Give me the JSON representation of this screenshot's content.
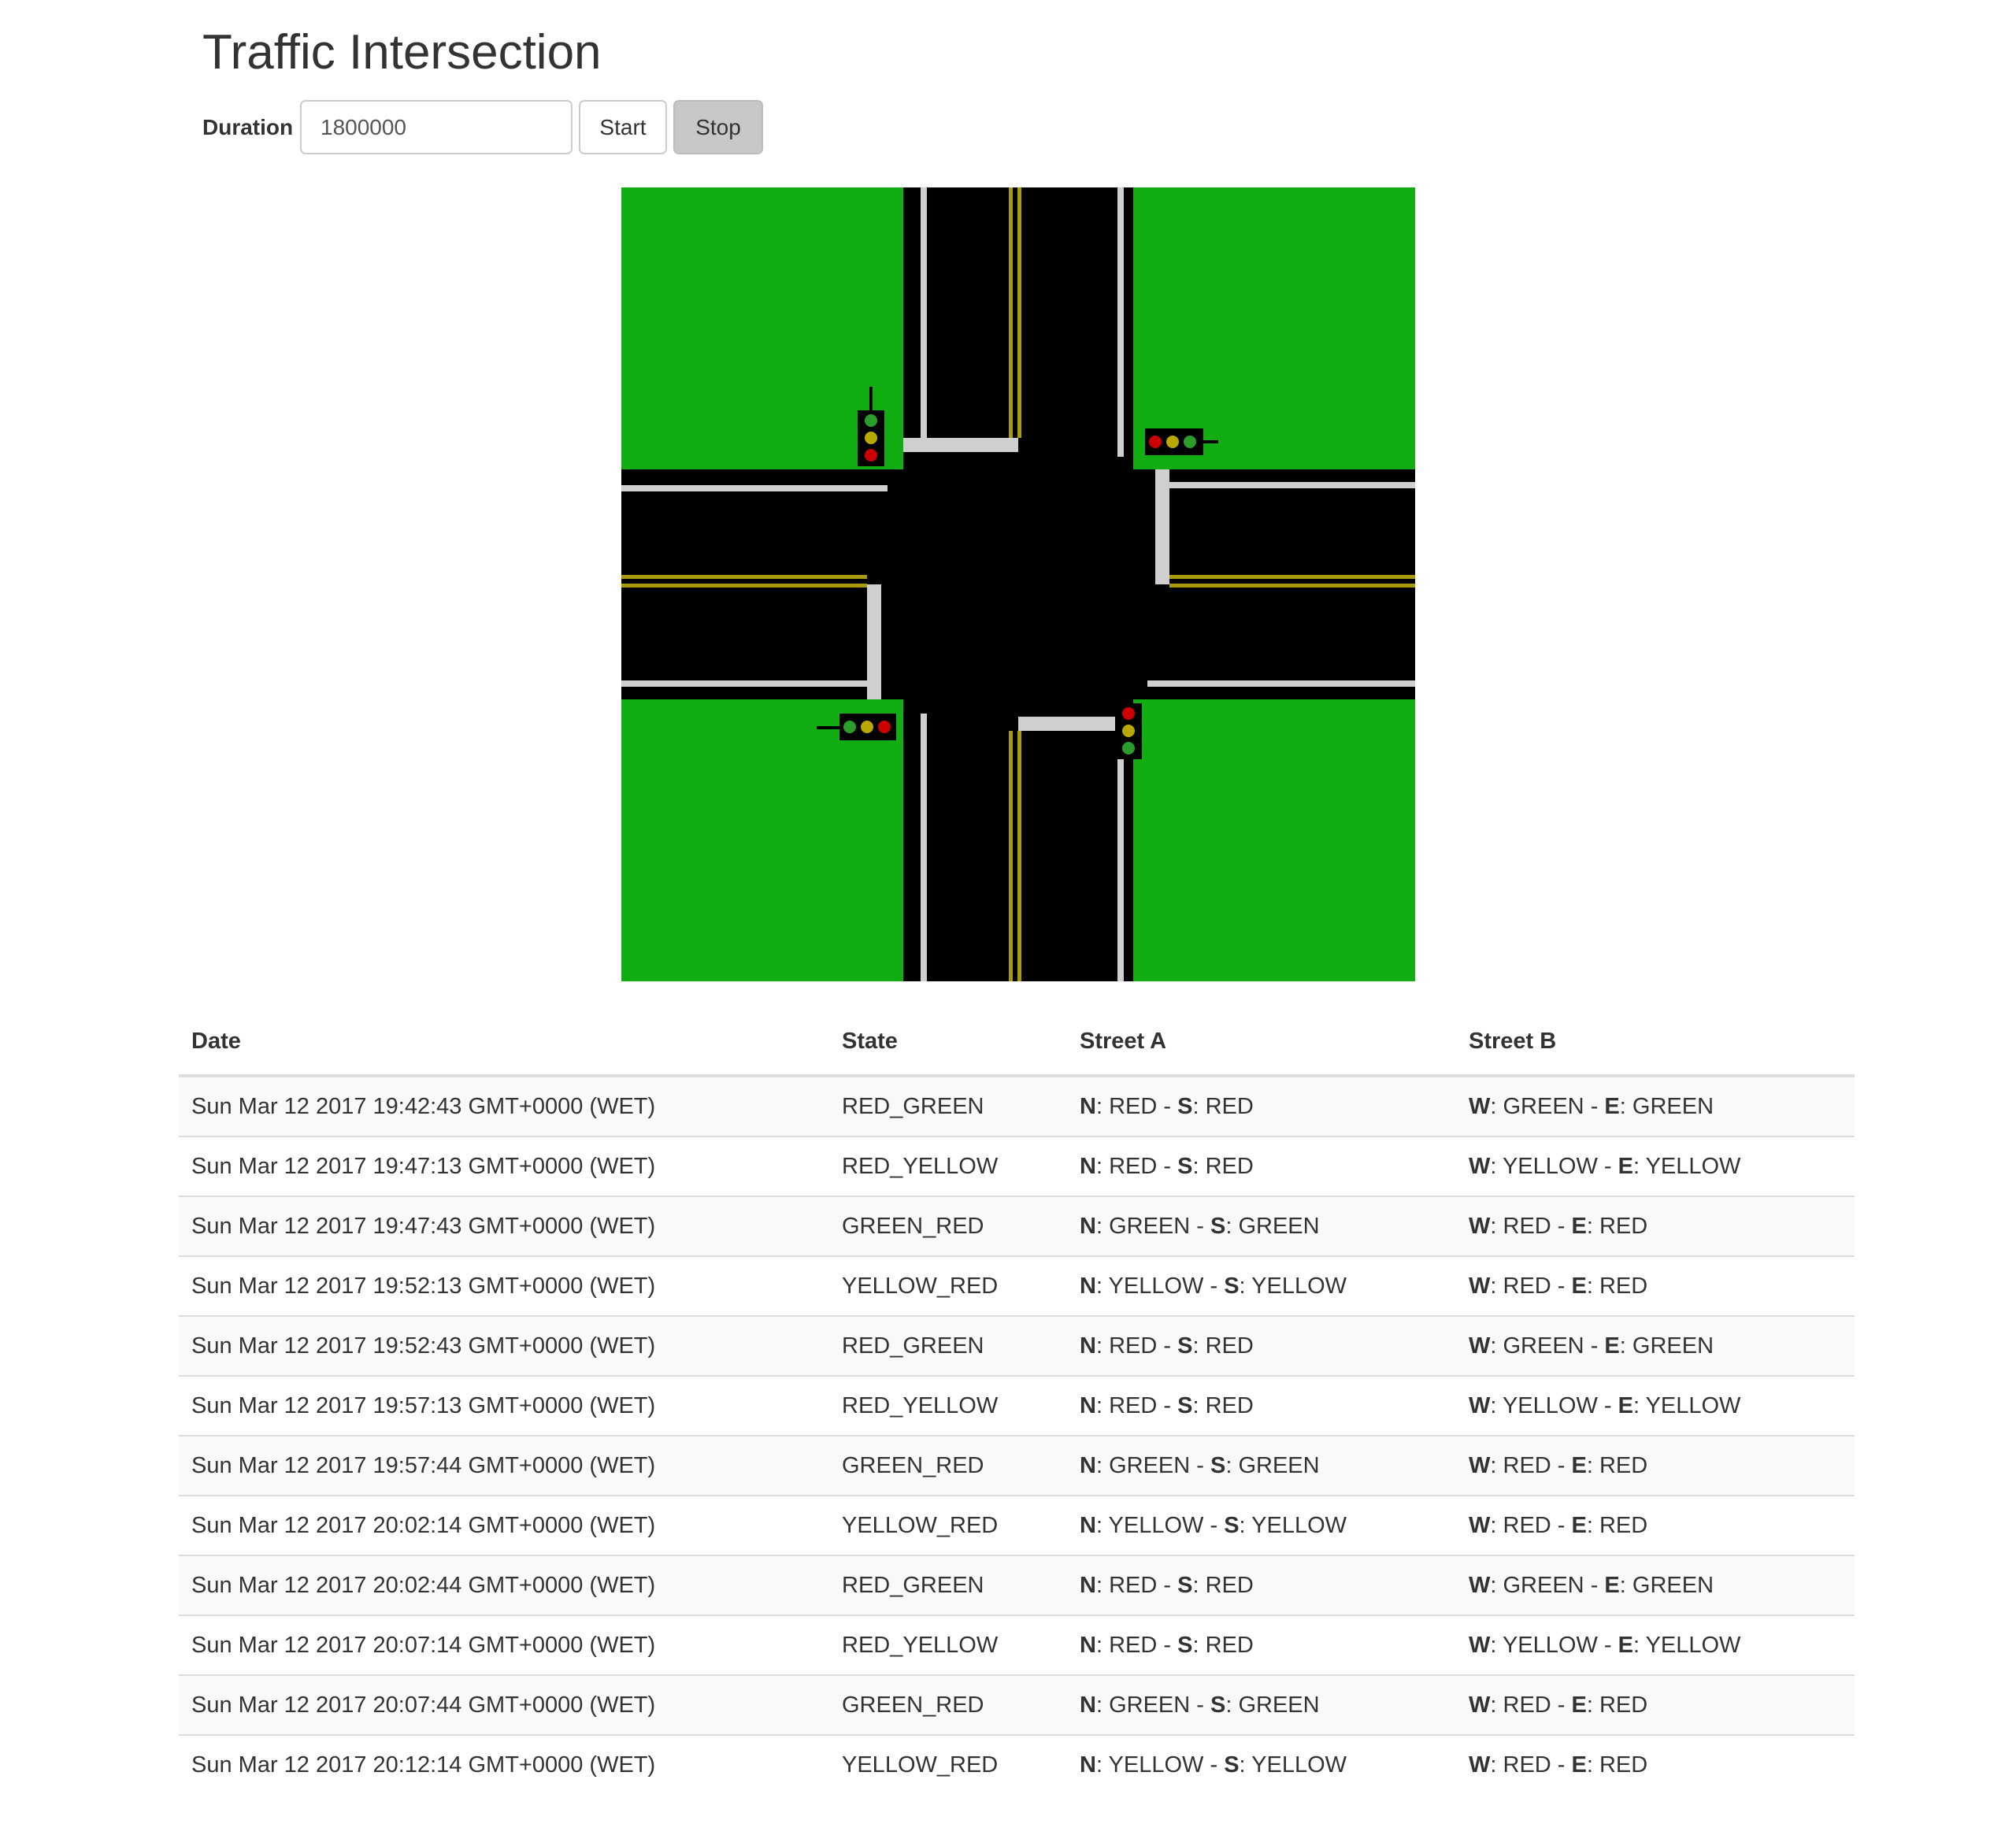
{
  "title": "Traffic Intersection",
  "controls": {
    "duration_label": "Duration",
    "duration_value": "1800000",
    "start_label": "Start",
    "stop_label": "Stop"
  },
  "colors": {
    "grass": "#12ad12",
    "road": "#000000",
    "lane_line": "#cfcfcf",
    "center_line": "#a89a08",
    "light_red": "#cc0000",
    "light_yellow": "#b8a800",
    "light_green": "#2a9d2a"
  },
  "lights": {
    "north": [
      "green",
      "yellow",
      "red"
    ],
    "east": [
      "red",
      "yellow",
      "green"
    ],
    "south": [
      "red",
      "yellow",
      "green"
    ],
    "west": [
      "green",
      "yellow",
      "red"
    ]
  },
  "table": {
    "headers": [
      "Date",
      "State",
      "Street A",
      "Street B"
    ],
    "rows": [
      {
        "date": "Sun Mar 12 2017 19:42:43 GMT+0000 (WET)",
        "state": "RED_GREEN",
        "a": {
          "k1": "N",
          "v1": "RED",
          "sep": " - ",
          "k2": "S",
          "v2": "RED"
        },
        "b": {
          "k1": "W",
          "v1": "GREEN",
          "sep": " - ",
          "k2": "E",
          "v2": "GREEN"
        }
      },
      {
        "date": "Sun Mar 12 2017 19:47:13 GMT+0000 (WET)",
        "state": "RED_YELLOW",
        "a": {
          "k1": "N",
          "v1": "RED",
          "sep": " - ",
          "k2": "S",
          "v2": "RED"
        },
        "b": {
          "k1": "W",
          "v1": "YELLOW",
          "sep": " - ",
          "k2": "E",
          "v2": "YELLOW"
        }
      },
      {
        "date": "Sun Mar 12 2017 19:47:43 GMT+0000 (WET)",
        "state": "GREEN_RED",
        "a": {
          "k1": "N",
          "v1": "GREEN",
          "sep": " - ",
          "k2": "S",
          "v2": "GREEN"
        },
        "b": {
          "k1": "W",
          "v1": "RED",
          "sep": " - ",
          "k2": "E",
          "v2": "RED"
        }
      },
      {
        "date": "Sun Mar 12 2017 19:52:13 GMT+0000 (WET)",
        "state": "YELLOW_RED",
        "a": {
          "k1": "N",
          "v1": "YELLOW",
          "sep": " - ",
          "k2": "S",
          "v2": "YELLOW"
        },
        "b": {
          "k1": "W",
          "v1": "RED",
          "sep": " - ",
          "k2": "E",
          "v2": "RED"
        }
      },
      {
        "date": "Sun Mar 12 2017 19:52:43 GMT+0000 (WET)",
        "state": "RED_GREEN",
        "a": {
          "k1": "N",
          "v1": "RED",
          "sep": " - ",
          "k2": "S",
          "v2": "RED"
        },
        "b": {
          "k1": "W",
          "v1": "GREEN",
          "sep": " - ",
          "k2": "E",
          "v2": "GREEN"
        }
      },
      {
        "date": "Sun Mar 12 2017 19:57:13 GMT+0000 (WET)",
        "state": "RED_YELLOW",
        "a": {
          "k1": "N",
          "v1": "RED",
          "sep": " - ",
          "k2": "S",
          "v2": "RED"
        },
        "b": {
          "k1": "W",
          "v1": "YELLOW",
          "sep": " - ",
          "k2": "E",
          "v2": "YELLOW"
        }
      },
      {
        "date": "Sun Mar 12 2017 19:57:44 GMT+0000 (WET)",
        "state": "GREEN_RED",
        "a": {
          "k1": "N",
          "v1": "GREEN",
          "sep": " - ",
          "k2": "S",
          "v2": "GREEN"
        },
        "b": {
          "k1": "W",
          "v1": "RED",
          "sep": " - ",
          "k2": "E",
          "v2": "RED"
        }
      },
      {
        "date": "Sun Mar 12 2017 20:02:14 GMT+0000 (WET)",
        "state": "YELLOW_RED",
        "a": {
          "k1": "N",
          "v1": "YELLOW",
          "sep": " - ",
          "k2": "S",
          "v2": "YELLOW"
        },
        "b": {
          "k1": "W",
          "v1": "RED",
          "sep": " - ",
          "k2": "E",
          "v2": "RED"
        }
      },
      {
        "date": "Sun Mar 12 2017 20:02:44 GMT+0000 (WET)",
        "state": "RED_GREEN",
        "a": {
          "k1": "N",
          "v1": "RED",
          "sep": " - ",
          "k2": "S",
          "v2": "RED"
        },
        "b": {
          "k1": "W",
          "v1": "GREEN",
          "sep": " - ",
          "k2": "E",
          "v2": "GREEN"
        }
      },
      {
        "date": "Sun Mar 12 2017 20:07:14 GMT+0000 (WET)",
        "state": "RED_YELLOW",
        "a": {
          "k1": "N",
          "v1": "RED",
          "sep": " - ",
          "k2": "S",
          "v2": "RED"
        },
        "b": {
          "k1": "W",
          "v1": "YELLOW",
          "sep": " - ",
          "k2": "E",
          "v2": "YELLOW"
        }
      },
      {
        "date": "Sun Mar 12 2017 20:07:44 GMT+0000 (WET)",
        "state": "GREEN_RED",
        "a": {
          "k1": "N",
          "v1": "GREEN",
          "sep": " - ",
          "k2": "S",
          "v2": "GREEN"
        },
        "b": {
          "k1": "W",
          "v1": "RED",
          "sep": " - ",
          "k2": "E",
          "v2": "RED"
        }
      },
      {
        "date": "Sun Mar 12 2017 20:12:14 GMT+0000 (WET)",
        "state": "YELLOW_RED",
        "a": {
          "k1": "N",
          "v1": "YELLOW",
          "sep": " - ",
          "k2": "S",
          "v2": "YELLOW"
        },
        "b": {
          "k1": "W",
          "v1": "RED",
          "sep": " - ",
          "k2": "E",
          "v2": "RED"
        }
      }
    ]
  }
}
